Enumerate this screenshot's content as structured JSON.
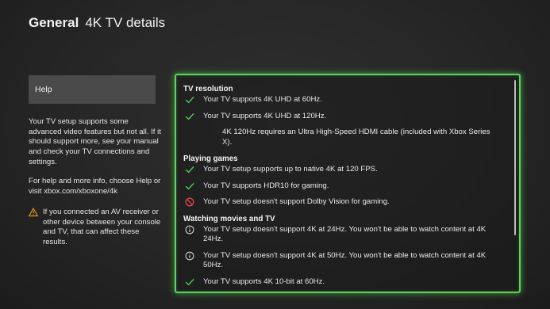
{
  "header": {
    "section": "General",
    "page": "4K TV details"
  },
  "sidebar": {
    "help_label": "Help",
    "paragraph1": "Your TV setup supports some advanced video features but not all. If it should support more, see your manual and check your TV connections and settings.",
    "paragraph2": "For help and more info, choose Help or visit xbox.com/xboxone/4k",
    "warning": "If you connected an AV receiver or other device between your console and TV, that can affect these results."
  },
  "panel": {
    "sections": [
      {
        "title": "TV resolution",
        "items": [
          {
            "icon": "check-icon",
            "text": "Your TV supports 4K UHD at 60Hz."
          },
          {
            "icon": "check-icon",
            "text": "Your TV supports 4K UHD at 120Hz."
          },
          {
            "icon": "none",
            "text": "4K 120Hz requires an Ultra High-Speed HDMI cable (included with Xbox Series X)."
          }
        ]
      },
      {
        "title": "Playing games",
        "items": [
          {
            "icon": "check-icon",
            "text": "Your TV setup supports up to native 4K at 120 FPS."
          },
          {
            "icon": "check-icon",
            "text": "Your TV supports HDR10 for gaming."
          },
          {
            "icon": "prohibited-icon",
            "text": "Your TV setup doesn't support Dolby Vision for gaming."
          }
        ]
      },
      {
        "title": "Watching movies and TV",
        "items": [
          {
            "icon": "info-icon",
            "text": "Your TV setup doesn't support 4K at 24Hz. You won't be able to watch content at 4K 24Hz."
          },
          {
            "icon": "info-icon",
            "text": "Your TV setup doesn't support 4K at 50Hz. You won't be able to watch content at 4K 50Hz."
          },
          {
            "icon": "check-icon",
            "text": "Your TV supports 4K 10-bit at 60Hz."
          }
        ]
      }
    ]
  },
  "colors": {
    "accent_green": "#5dd35d",
    "check_green": "#5cc85c",
    "prohibited_red": "#e0444a",
    "warning_orange": "#f0a020"
  }
}
